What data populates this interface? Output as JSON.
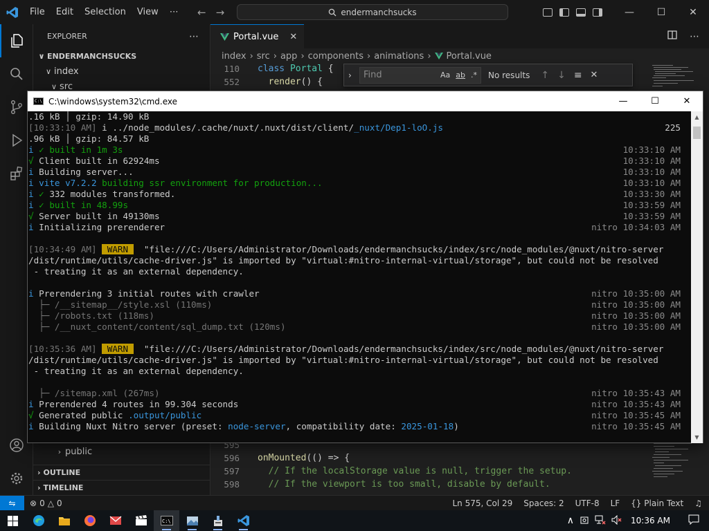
{
  "vscode": {
    "menu": [
      "File",
      "Edit",
      "Selection",
      "View",
      "⋯"
    ],
    "command_center": "endermanchsucks",
    "sidebar": {
      "title": "EXPLORER",
      "more": "⋯",
      "tree": [
        {
          "label": "ENDERMANCHSUCKS",
          "depth": 0,
          "chev": "∨",
          "bold": true
        },
        {
          "label": "index",
          "depth": 1,
          "chev": "∨"
        },
        {
          "label": "src",
          "depth": 2,
          "chev": "∨"
        }
      ],
      "public_folder": "public",
      "outline": "OUTLINE",
      "timeline": "TIMELINE"
    },
    "tab": {
      "label": "Portal.vue",
      "close": "✕"
    },
    "breadcrumb": [
      "index",
      "src",
      "app",
      "components",
      "animations",
      "Portal.vue"
    ],
    "find": {
      "placeholder": "Find",
      "result": "No results",
      "aa": "Aa",
      "ab": "ab",
      "regex": ".*"
    },
    "code_top": [
      {
        "ln": "110",
        "parts": [
          [
            "kw",
            "class "
          ],
          [
            "cls",
            "Portal "
          ],
          [
            "pl",
            "{"
          ]
        ]
      },
      {
        "ln": "552",
        "parts": [
          [
            "pl",
            "  "
          ],
          [
            "fn",
            "render"
          ],
          [
            "pl",
            "() {"
          ]
        ]
      }
    ],
    "code_bottom": [
      {
        "ln": "595",
        "parts": [
          [
            "pl",
            ""
          ]
        ]
      },
      {
        "ln": "596",
        "parts": [
          [
            "fn",
            "onMounted"
          ],
          [
            "pl",
            "(() => {"
          ]
        ]
      },
      {
        "ln": "597",
        "parts": [
          [
            "cm",
            "  // If the localStorage value is null, trigger the setup."
          ]
        ]
      },
      {
        "ln": "598",
        "parts": [
          [
            "cm",
            "  // If the viewport is too small, disable by default."
          ]
        ]
      }
    ],
    "status": {
      "errors": "0",
      "warnings": "0",
      "position": "Ln 575, Col 29",
      "spaces": "Spaces: 2",
      "encoding": "UTF-8",
      "eol": "LF",
      "language": "Plain Text",
      "braces": "{}"
    }
  },
  "cmd": {
    "title": "C:\\windows\\system32\\cmd.exe",
    "lines": [
      {
        "l": [
          [
            "",
            ".16 kB │ gzip: 14.90 kB"
          ]
        ],
        "r": ""
      },
      {
        "l": [
          [
            "c-grey",
            "[10:33:10 AM] "
          ],
          [
            "",
            "i ../node_modules/.cache/nuxt/.nuxt/dist/client/"
          ],
          [
            "c-cyan",
            "_nuxt/Dep1-loO.js"
          ]
        ],
        "r": "225",
        "rcls": "plain"
      },
      {
        "l": [
          [
            "",
            ".96 kB │ gzip: 84.57 kB"
          ]
        ],
        "r": ""
      },
      {
        "l": [
          [
            "c-cyan",
            "i "
          ],
          [
            "c-green",
            "✓ built in 1m 3s"
          ]
        ],
        "r": "10:33:10 AM"
      },
      {
        "l": [
          [
            "c-green",
            "√ "
          ],
          [
            "",
            "Client built in 62924ms"
          ]
        ],
        "r": "10:33:10 AM"
      },
      {
        "l": [
          [
            "c-cyan",
            "i "
          ],
          [
            "",
            "Building server..."
          ]
        ],
        "r": "10:33:10 AM"
      },
      {
        "l": [
          [
            "c-cyan",
            "i "
          ],
          [
            "c-cyan",
            "vite v7.2.2 "
          ],
          [
            "c-green",
            "building ssr environment for production..."
          ]
        ],
        "r": "10:33:10 AM"
      },
      {
        "l": [
          [
            "c-cyan",
            "i "
          ],
          [
            "c-green",
            "✓ "
          ],
          [
            "",
            "332 modules transformed."
          ]
        ],
        "r": "10:33:30 AM"
      },
      {
        "l": [
          [
            "c-cyan",
            "i "
          ],
          [
            "c-green",
            "✓ built in 48.99s"
          ]
        ],
        "r": "10:33:59 AM"
      },
      {
        "l": [
          [
            "c-green",
            "√ "
          ],
          [
            "",
            "Server built in 49130ms"
          ]
        ],
        "r": "10:33:59 AM"
      },
      {
        "l": [
          [
            "c-cyan",
            "i "
          ],
          [
            "",
            "Initializing prerenderer"
          ]
        ],
        "r": "nitro 10:34:03 AM"
      },
      {
        "l": [],
        "r": ""
      },
      {
        "l": [
          [
            "c-grey",
            "[10:34:49 AM] "
          ],
          [
            "c-warn",
            " WARN "
          ],
          [
            "",
            "  \"file:///C:/Users/Administrator/Downloads/endermanchsucks/index/src/node_modules/@nuxt/nitro-server"
          ]
        ],
        "r": ""
      },
      {
        "l": [
          [
            "",
            "/dist/runtime/utils/cache-driver.js\" is imported by \"virtual:#nitro-internal-virtual/storage\", but could not be resolved"
          ]
        ],
        "r": ""
      },
      {
        "l": [
          [
            "",
            " - treating it as an external dependency."
          ]
        ],
        "r": ""
      },
      {
        "l": [],
        "r": ""
      },
      {
        "l": [
          [
            "c-cyan",
            "i "
          ],
          [
            "",
            "Prerendering 3 initial routes with crawler"
          ]
        ],
        "r": "nitro 10:35:00 AM"
      },
      {
        "l": [
          [
            "c-grey",
            "  ├─ /__sitemap__/style.xsl (110ms)"
          ]
        ],
        "r": "nitro 10:35:00 AM"
      },
      {
        "l": [
          [
            "c-grey",
            "  ├─ /robots.txt (118ms)"
          ]
        ],
        "r": "nitro 10:35:00 AM"
      },
      {
        "l": [
          [
            "c-grey",
            "  ├─ /__nuxt_content/content/sql_dump.txt (120ms)"
          ]
        ],
        "r": "nitro 10:35:00 AM"
      },
      {
        "l": [],
        "r": ""
      },
      {
        "l": [
          [
            "c-grey",
            "[10:35:36 AM] "
          ],
          [
            "c-warn",
            " WARN "
          ],
          [
            "",
            "  \"file:///C:/Users/Administrator/Downloads/endermanchsucks/index/src/node_modules/@nuxt/nitro-server"
          ]
        ],
        "r": ""
      },
      {
        "l": [
          [
            "",
            "/dist/runtime/utils/cache-driver.js\" is imported by \"virtual:#nitro-internal-virtual/storage\", but could not be resolved"
          ]
        ],
        "r": ""
      },
      {
        "l": [
          [
            "",
            " - treating it as an external dependency."
          ]
        ],
        "r": ""
      },
      {
        "l": [],
        "r": ""
      },
      {
        "l": [
          [
            "c-grey",
            "  ├─ /sitemap.xml (267ms)"
          ]
        ],
        "r": "nitro 10:35:43 AM"
      },
      {
        "l": [
          [
            "c-cyan",
            "i "
          ],
          [
            "",
            "Prerendered 4 routes in 99.304 seconds"
          ]
        ],
        "r": "nitro 10:35:43 AM"
      },
      {
        "l": [
          [
            "c-green",
            "√ "
          ],
          [
            "",
            "Generated public "
          ],
          [
            "c-cyan",
            ".output/public"
          ]
        ],
        "r": "nitro 10:35:45 AM"
      },
      {
        "l": [
          [
            "c-cyan",
            "i "
          ],
          [
            "",
            "Building Nuxt Nitro server (preset: "
          ],
          [
            "c-cyan",
            "node-server"
          ],
          [
            "",
            ", compatibility date: "
          ],
          [
            "c-cyan",
            "2025-01-18"
          ],
          [
            "",
            ")"
          ]
        ],
        "r": "nitro 10:35:45 AM"
      }
    ]
  },
  "taskbar": {
    "clock": "10:36 AM",
    "tray_up": "∧"
  },
  "colors": {
    "accent": "#0078d4",
    "cmd_bg": "#0c0c0c",
    "warn": "#c19c00",
    "vue_green": "#41b883"
  }
}
